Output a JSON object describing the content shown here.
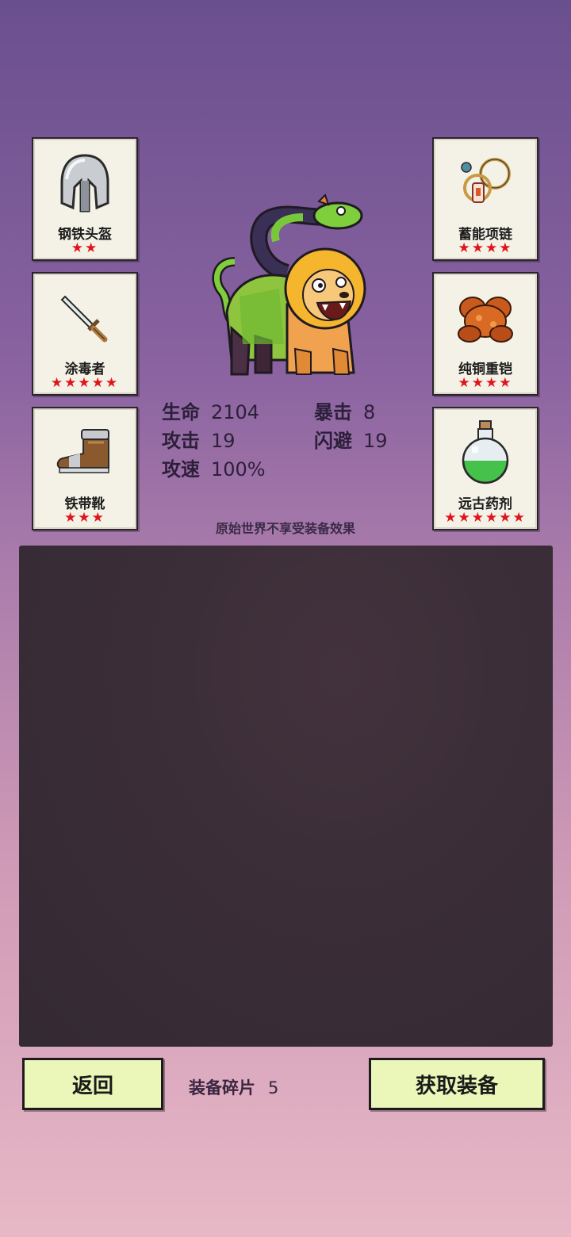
{
  "equipment_left": [
    {
      "name": "钢铁头盔",
      "stars": "★★"
    },
    {
      "name": "涂毒者",
      "stars": "★★★★★"
    },
    {
      "name": "铁带靴",
      "stars": "★★★"
    }
  ],
  "equipment_right": [
    {
      "name": "蓄能项链",
      "stars": "★★★★"
    },
    {
      "name": "纯铜重铠",
      "stars": "★★★★"
    },
    {
      "name": "远古药剂",
      "stars": "★★★★★★"
    }
  ],
  "stats": {
    "hp_label": "生命",
    "hp_value": "2104",
    "crit_label": "暴击",
    "crit_value": "8",
    "atk_label": "攻击",
    "atk_value": "19",
    "dodge_label": "闪避",
    "dodge_value": "19",
    "speed_label": "攻速",
    "speed_value": "100%"
  },
  "note": "原始世界不享受装备效果",
  "footer": {
    "back_label": "返回",
    "fragments_label": "装备碎片",
    "fragments_value": "5",
    "get_label": "获取装备"
  },
  "icons": {
    "helmet": "helmet-icon",
    "dagger": "dagger-icon",
    "boot": "boot-icon",
    "necklace": "necklace-icon",
    "armor": "armor-icon",
    "potion": "potion-icon",
    "monster": "chimera-sprite"
  }
}
